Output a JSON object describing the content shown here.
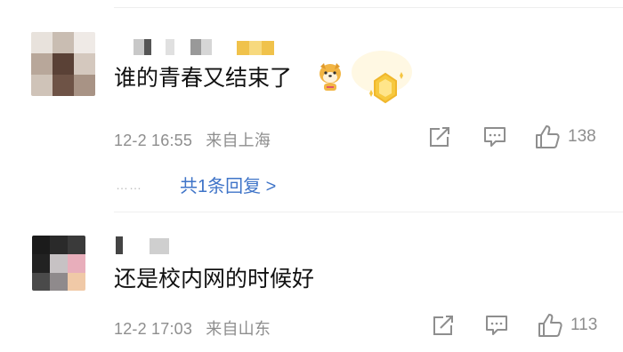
{
  "comments": [
    {
      "text": "谁的青春又结束了",
      "time": "12-2 16:55",
      "location": "来自上海",
      "likes": "138",
      "reply_link": "共1条回复 >",
      "reply_dots": "……"
    },
    {
      "text": "还是校内网的时候好",
      "time": "12-2 17:03",
      "location": "来自山东",
      "likes": "113"
    }
  ],
  "icons": [
    "share-icon",
    "comment-icon",
    "thumbs-up-icon",
    "dog-emoji-icon",
    "vip-badge-icon"
  ],
  "colors": {
    "link": "#3f74c8",
    "meta": "#8e8e8e",
    "badge": "#f5c542"
  }
}
